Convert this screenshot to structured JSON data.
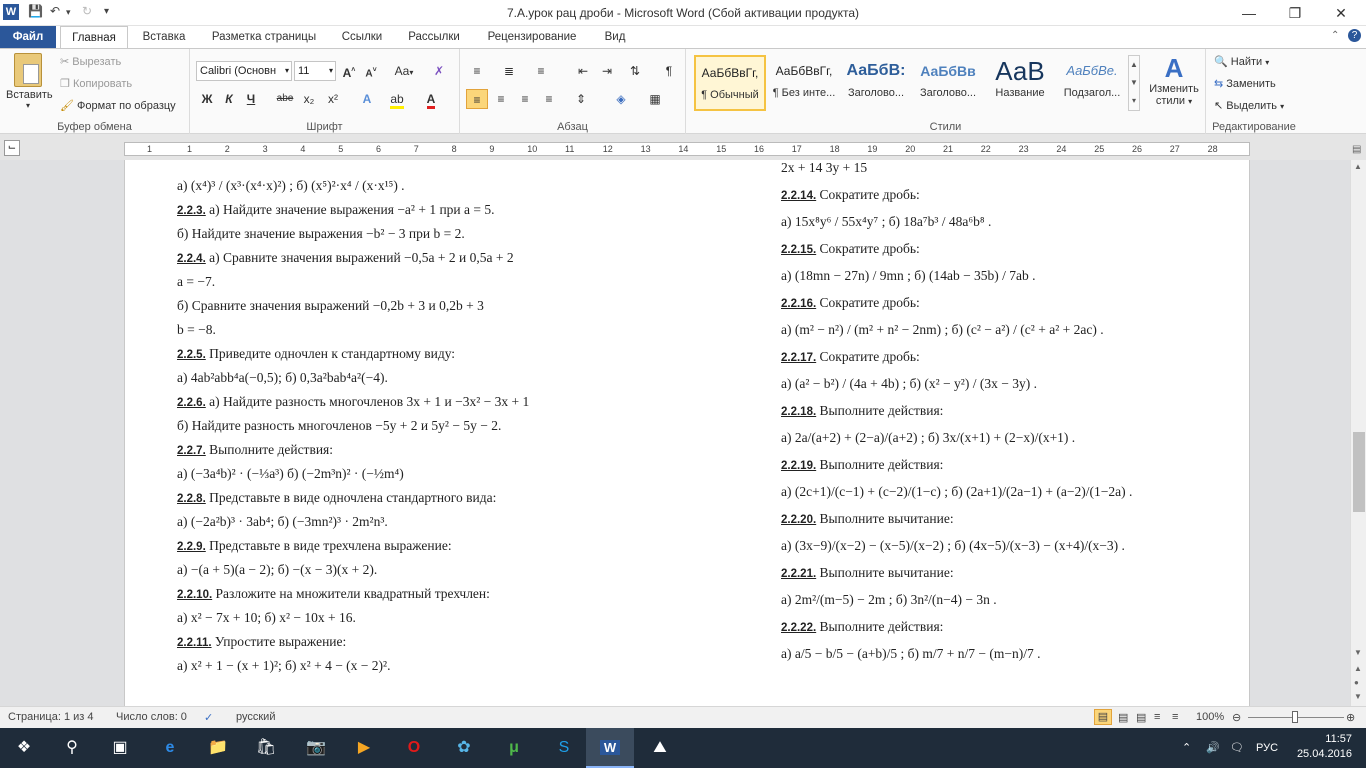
{
  "window": {
    "title": "7.А.урок рац дроби  -  Microsoft Word (Сбой активации продукта)",
    "app_icon": "W"
  },
  "tabs": {
    "file": "Файл",
    "home": "Главная",
    "insert": "Вставка",
    "layout": "Разметка страницы",
    "references": "Ссылки",
    "mailings": "Рассылки",
    "review": "Рецензирование",
    "view": "Вид"
  },
  "clipboard": {
    "paste": "Вставить",
    "cut": "Вырезать",
    "copy": "Копировать",
    "format_painter": "Формат по образцу",
    "label": "Буфер обмена"
  },
  "font": {
    "name": "Calibri (Основн",
    "size": "11",
    "label": "Шрифт",
    "aa": "Aa",
    "bold": "Ж",
    "italic": "К",
    "underline": "Ч",
    "strike": "abe",
    "sub": "x₂",
    "sup": "x²"
  },
  "paragraph": {
    "label": "Абзац"
  },
  "styles": {
    "label": "Стили",
    "items": [
      {
        "sample": "АаБбВвГг,",
        "name": "¶ Обычный"
      },
      {
        "sample": "АаБбВвГг,",
        "name": "¶ Без инте..."
      },
      {
        "sample": "АаБбВ:",
        "name": "Заголово..."
      },
      {
        "sample": "АаБбВв",
        "name": "Заголово..."
      },
      {
        "sample": "АаВ",
        "name": "Название"
      },
      {
        "sample": "АаБбВе.",
        "name": "Подзагол..."
      }
    ],
    "change": "Изменить",
    "change2": "стили"
  },
  "editing": {
    "label": "Редактирование",
    "find": "Найти",
    "replace": "Заменить",
    "select": "Выделить"
  },
  "ruler": {
    "numbers": [
      "1",
      "1",
      "2",
      "3",
      "4",
      "5",
      "6",
      "7",
      "8",
      "9",
      "10",
      "11",
      "12",
      "13",
      "14",
      "15",
      "16",
      "17",
      "18",
      "19",
      "20",
      "21",
      "22",
      "23",
      "24",
      "25",
      "26",
      "27",
      "28"
    ]
  },
  "document": {
    "left": [
      {
        "n": "",
        "t": "а)  (x⁴)³ / (x³·(x⁴·x)²) ;                        б)  (x⁵)²·x⁴ / (x·x¹⁵) ."
      },
      {
        "n": "2.2.3.",
        "t": " а) Найдите значение выражения −a² + 1 при a = 5."
      },
      {
        "n": "",
        "t": "       б) Найдите значение выражения −b² − 3 при b = 2."
      },
      {
        "n": "2.2.4.",
        "t": " а) Сравните значения выражений −0,5a + 2 и 0,5a + 2"
      },
      {
        "n": "",
        "t": "a = −7."
      },
      {
        "n": "",
        "t": "       б) Сравните значения выражений −0,2b + 3 и 0,2b + 3"
      },
      {
        "n": "",
        "t": "b = −8."
      },
      {
        "n": "2.2.5.",
        "t": " Приведите одночлен к стандартному виду:"
      },
      {
        "n": "",
        "t": "       а) 4ab²abb⁴a(−0,5);                         б) 0,3a²bab⁴a²(−4)."
      },
      {
        "n": "2.2.6.",
        "t": " а) Найдите разность многочленов 3x + 1 и −3x² − 3x + 1"
      },
      {
        "n": "",
        "t": "       б) Найдите разность многочленов −5y + 2 и 5y² − 5y − 2."
      },
      {
        "n": "2.2.7.",
        "t": " Выполните действия:"
      },
      {
        "n": "",
        "t": "       а) (−3a⁴b)² · (−⅓a³)                          б) (−2m³n)² · (−½m⁴)"
      },
      {
        "n": "2.2.8.",
        "t": " Представьте в виде одночлена стандартного вида:"
      },
      {
        "n": "",
        "t": "       а) (−2a²b)³ · 3ab⁴;                           б) (−3mn²)³ · 2m²n³."
      },
      {
        "n": "2.2.9.",
        "t": " Представьте в виде трехчлена выражение:"
      },
      {
        "n": "",
        "t": "       а) −(a + 5)(a − 2);                              б) −(x − 3)(x + 2)."
      },
      {
        "n": "2.2.10.",
        "t": " Разложите на множители квадратный трехчлен:"
      },
      {
        "n": "",
        "t": "       а) x² − 7x + 10;                                б) x² − 10x + 16."
      },
      {
        "n": "2.2.11.",
        "t": " Упростите выражение:"
      },
      {
        "n": "",
        "t": "       а) x² + 1 − (x + 1)²;                          б) x² + 4 − (x − 2)²."
      }
    ],
    "right": [
      {
        "n": "",
        "t": "       2x + 14                                                        3y + 15"
      },
      {
        "n": "2.2.14.",
        "t": " Сократите дробь:"
      },
      {
        "n": "",
        "t": "  а)  15x⁸y⁶ / 55x⁴y⁷ ;                              б)  18a⁷b³ / 48a⁶b⁸ ."
      },
      {
        "n": "2.2.15.",
        "t": " Сократите дробь:"
      },
      {
        "n": "",
        "t": "  а)  (18mn − 27n) / 9mn ;                          б)  (14ab − 35b) / 7ab ."
      },
      {
        "n": "2.2.16.",
        "t": " Сократите дробь:"
      },
      {
        "n": "",
        "t": "  а)  (m² − n²) / (m² + n² − 2nm) ;                б)  (c² − a²) / (c² + a² + 2ac) ."
      },
      {
        "n": "2.2.17.",
        "t": " Сократите дробь:"
      },
      {
        "n": "",
        "t": "  а)  (a² − b²) / (4a + 4b) ;                        б)  (x² − y²) / (3x − 3y) ."
      },
      {
        "n": "2.2.18.",
        "t": " Выполните действия:"
      },
      {
        "n": "",
        "t": "  а)  2a/(a+2) + (2−a)/(a+2) ;                     б)  3x/(x+1) + (2−x)/(x+1) ."
      },
      {
        "n": "2.2.19.",
        "t": " Выполните действия:"
      },
      {
        "n": "",
        "t": "  а)  (2c+1)/(c−1) + (c−2)/(1−c) ;                б)  (2a+1)/(2a−1) + (a−2)/(1−2a) ."
      },
      {
        "n": "2.2.20.",
        "t": " Выполните вычитание:"
      },
      {
        "n": "",
        "t": "  а)  (3x−9)/(x−2) − (x−5)/(x−2) ;                б)  (4x−5)/(x−3) − (x+4)/(x−3) ."
      },
      {
        "n": "2.2.21.",
        "t": " Выполните вычитание:"
      },
      {
        "n": "",
        "t": "  а)  2m²/(m−5) − 2m ;                               б)  3n²/(n−4) − 3n ."
      },
      {
        "n": "2.2.22.",
        "t": " Выполните действия:"
      },
      {
        "n": "",
        "t": "  а)  a/5 − b/5 − (a+b)/5 ;                         б)  m/7 + n/7 − (m−n)/7 ."
      }
    ]
  },
  "status": {
    "page": "Страница: 1 из 4",
    "words": "Число слов: 0",
    "lang": "русский",
    "zoom": "100%"
  },
  "taskbar": {
    "lang": "РУС",
    "time": "11:57",
    "date": "25.04.2016"
  }
}
